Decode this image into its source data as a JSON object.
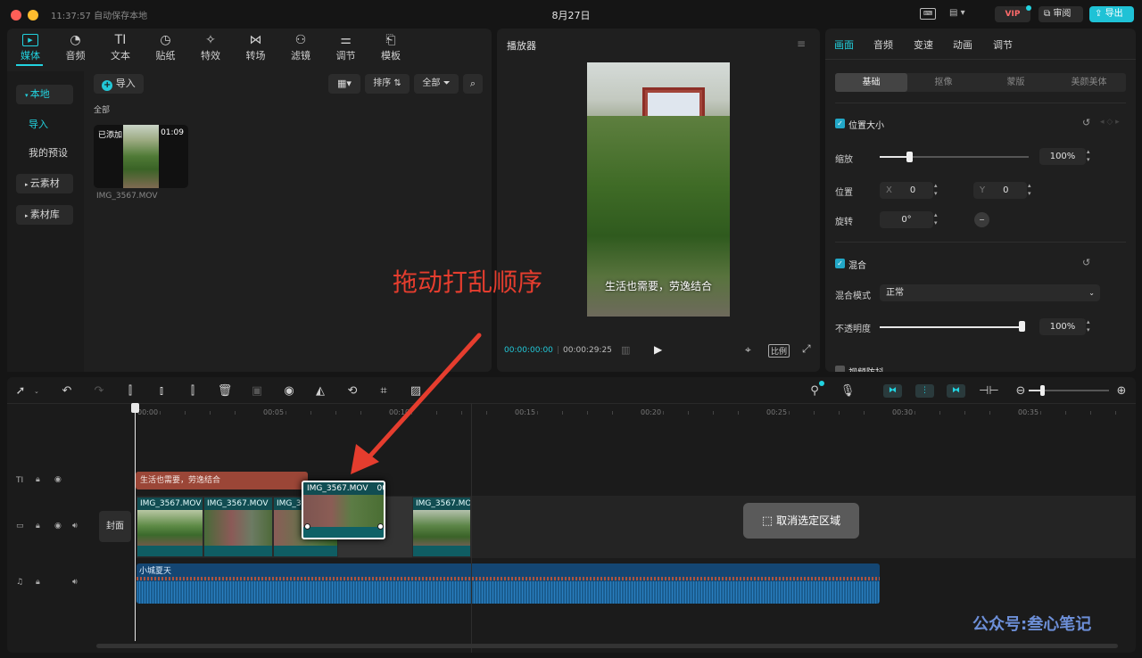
{
  "titlebar": {
    "autosave": "11:37:57 自动保存本地",
    "title": "8月27日",
    "vip_label": "VIP",
    "review_label": "审阅",
    "export_label": "导出"
  },
  "media": {
    "tabs": [
      {
        "label": "媒体",
        "icon": "media-icon"
      },
      {
        "label": "音频",
        "icon": "audio-icon"
      },
      {
        "label": "文本",
        "icon": "text-icon"
      },
      {
        "label": "贴纸",
        "icon": "sticker-icon"
      },
      {
        "label": "特效",
        "icon": "effects-icon"
      },
      {
        "label": "转场",
        "icon": "transition-icon"
      },
      {
        "label": "滤镜",
        "icon": "filter-icon"
      },
      {
        "label": "调节",
        "icon": "adjust-icon"
      },
      {
        "label": "模板",
        "icon": "template-icon"
      }
    ],
    "sidebar": [
      {
        "label": "本地"
      },
      {
        "label": "导入"
      },
      {
        "label": "我的预设"
      },
      {
        "label": "云素材"
      },
      {
        "label": "素材库"
      }
    ],
    "import_label": "导入",
    "sort_label": "排序",
    "filter_label": "全部",
    "section_label": "全部",
    "asset": {
      "badge": "已添加",
      "duration": "01:09",
      "name": "IMG_3567.MOV"
    }
  },
  "player": {
    "title": "播放器",
    "subtitle": "生活也需要，劳逸结合",
    "current_time": "00:00:00:00",
    "total_time": "00:00:29:25",
    "ratio_label": "比例"
  },
  "inspector": {
    "tabs": [
      "画面",
      "音频",
      "变速",
      "动画",
      "调节"
    ],
    "subtabs": [
      "基础",
      "抠像",
      "蒙版",
      "美颜美体"
    ],
    "pos_section": "位置大小",
    "scale_label": "缩放",
    "scale_value": "100%",
    "position_label": "位置",
    "x_label": "X",
    "x_value": "0",
    "y_label": "Y",
    "y_value": "0",
    "rotate_label": "旋转",
    "rotate_value": "0°",
    "blend_section": "混合",
    "blend_mode_label": "混合模式",
    "blend_mode_value": "正常",
    "opacity_label": "不透明度",
    "opacity_value": "100%",
    "cut_section": "视频防抖"
  },
  "overlay": {
    "annotation": "拖动打乱顺序",
    "watermark": "公众号:叁心笔记"
  },
  "timeline": {
    "ruler": [
      "00:00",
      "00:05",
      "00:10",
      "00:15",
      "00:20",
      "00:25",
      "00:30",
      "00:35"
    ],
    "text_clip": "生活也需要，劳逸结合",
    "cover_label": "封面",
    "video_clips": [
      {
        "label": "IMG_3567.MOV"
      },
      {
        "label": "IMG_3567.MOV"
      },
      {
        "label": "IMG_3"
      },
      {
        "label": "IMG_3567.MOV"
      }
    ],
    "dragged_clip": {
      "label": "IMG_3567.MOV",
      "extra": "00"
    },
    "deselect_label": "取消选定区域",
    "audio_clip": "小城夏天"
  }
}
